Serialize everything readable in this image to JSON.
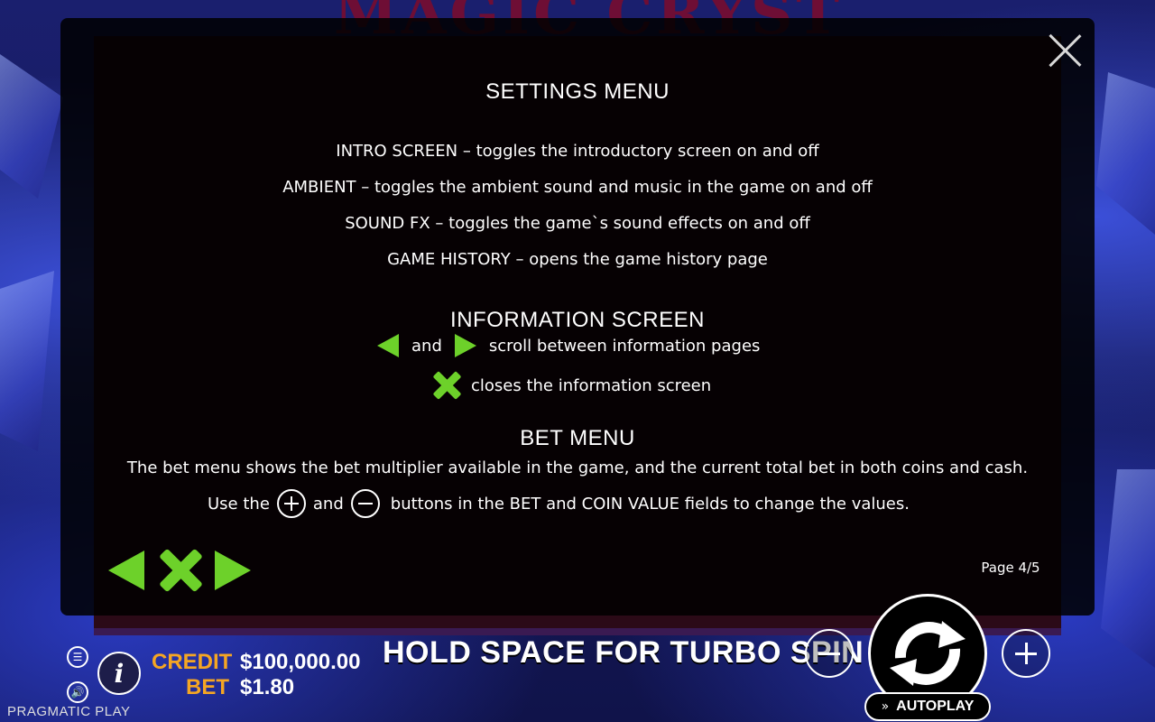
{
  "game": {
    "title": "MAGIC CRYSTALS",
    "brand": "PRAGMATIC PLAY"
  },
  "settings": {
    "heading": "SETTINGS MENU",
    "lines": [
      "INTRO SCREEN – toggles the introductory screen on and off",
      "AMBIENT – toggles the ambient sound and music in the game on and off",
      "SOUND FX – toggles the game`s sound effects on and off",
      "GAME HISTORY – opens the game history page"
    ]
  },
  "information": {
    "heading": "INFORMATION SCREEN",
    "and": "and",
    "scroll_text": "scroll between information pages",
    "close_text": "closes the information screen"
  },
  "bet_menu": {
    "heading": "BET MENU",
    "line1": "The bet menu shows the bet multiplier available in the game, and the current total bet in both coins and cash.",
    "use_the": "Use the",
    "and": "and",
    "line2_end": "buttons in the BET and COIN VALUE fields to change the values."
  },
  "pagination": {
    "page": "Page 4/5"
  },
  "bottom_bar": {
    "credit_label": "CREDIT",
    "credit_value": "$100,000.00",
    "bet_label": "BET",
    "bet_value": "$1.80",
    "turbo_text": "HOLD SPACE FOR TURBO SPIN",
    "autoplay_label": "AUTOPLAY"
  },
  "colors": {
    "accent_green": "#6dd12a",
    "label_orange": "#f5a623",
    "panel_bg": "#000000"
  }
}
